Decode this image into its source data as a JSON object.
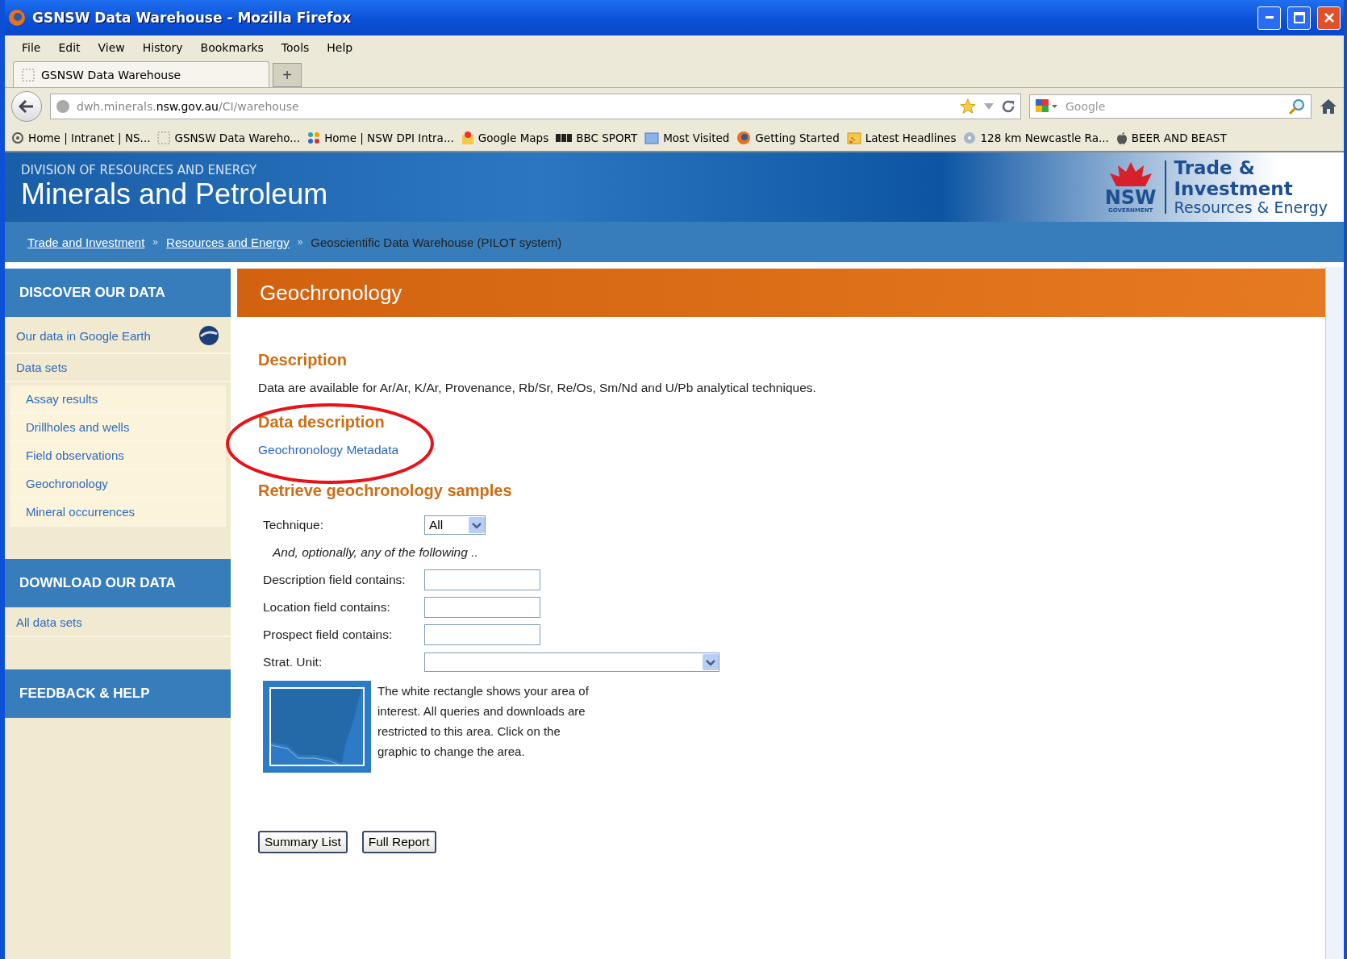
{
  "window": {
    "title": "GSNSW Data Warehouse - Mozilla Firefox"
  },
  "menu": [
    "File",
    "Edit",
    "View",
    "History",
    "Bookmarks",
    "Tools",
    "Help"
  ],
  "tabs": [
    {
      "label": "GSNSW Data Warehouse",
      "selected": true
    }
  ],
  "new_tab": "+",
  "address": {
    "host_prefix": "dwh.minerals.",
    "host_domain": "nsw.gov.au",
    "path": "/CI/warehouse"
  },
  "search": {
    "placeholder": "Google"
  },
  "bookmarks": [
    {
      "label": "Home | Intranet | NS...",
      "kind": "swirl"
    },
    {
      "label": "GSNSW Data Wareho...",
      "kind": "blank"
    },
    {
      "label": "Home | NSW DPI Intra...",
      "kind": "dots"
    },
    {
      "label": "Google Maps",
      "kind": "pin"
    },
    {
      "label": "BBC SPORT",
      "kind": "bbc"
    },
    {
      "label": "Most Visited",
      "kind": "folder"
    },
    {
      "label": "Getting Started",
      "kind": "firefox"
    },
    {
      "label": "Latest Headlines",
      "kind": "rss"
    },
    {
      "label": "128 km Newcastle Ra...",
      "kind": "disc"
    },
    {
      "label": "BEER AND BEAST",
      "kind": "apple"
    }
  ],
  "header": {
    "division": "DIVISION OF RESOURCES AND ENERGY",
    "title": "Minerals and Petroleum",
    "logo_word": "NSW",
    "logo_sub": "GOVERNMENT",
    "brand_lines": [
      "Trade &",
      "Investment",
      "Resources & Energy"
    ]
  },
  "breadcrumb": [
    {
      "label": "Trade and Investment",
      "link": true
    },
    {
      "label": "Resources and Energy",
      "link": true
    },
    {
      "label": "Geoscientific Data Warehouse (PILOT system)",
      "link": false
    }
  ],
  "breadcrumb_separator": "»",
  "sidebar": [
    {
      "heading": "DISCOVER OUR DATA",
      "items": [
        {
          "label": "Our data in Google Earth",
          "icon": true
        },
        {
          "label": "Data sets",
          "children": [
            {
              "label": "Assay results"
            },
            {
              "label": "Drillholes and wells"
            },
            {
              "label": "Field observations"
            },
            {
              "label": "Geochronology"
            },
            {
              "label": "Mineral occurrences"
            }
          ]
        }
      ]
    },
    {
      "heading": "DOWNLOAD OUR DATA",
      "items": [
        {
          "label": "All data sets"
        }
      ]
    },
    {
      "heading": "FEEDBACK & HELP"
    }
  ],
  "page": {
    "title": "Geochronology",
    "sections": [
      {
        "heading": "Description",
        "text": "Data are available for Ar/Ar, K/Ar, Provenance, Rb/Sr, Re/Os, Sm/Nd and U/Pb analytical techniques."
      },
      {
        "heading": "Data description",
        "link": "Geochronology Metadata",
        "annotated": true
      }
    ],
    "form_heading": "Retrieve geochronology samples",
    "form": [
      {
        "kind": "select",
        "label": "Technique:",
        "value": "All",
        "wide": false
      },
      {
        "kind": "note",
        "text": "And, optionally, any of the following .."
      },
      {
        "kind": "text",
        "label": "Description field contains:"
      },
      {
        "kind": "text",
        "label": "Location field contains:"
      },
      {
        "kind": "text",
        "label": "Prospect field contains:"
      },
      {
        "kind": "select",
        "label": "Strat. Unit:",
        "wide": true
      }
    ],
    "map_text": "The white rectangle shows your area of interest. All queries and downloads are restricted to this area. Click on the graphic to change the area.",
    "buttons": [
      "Summary List",
      "Full Report"
    ]
  }
}
